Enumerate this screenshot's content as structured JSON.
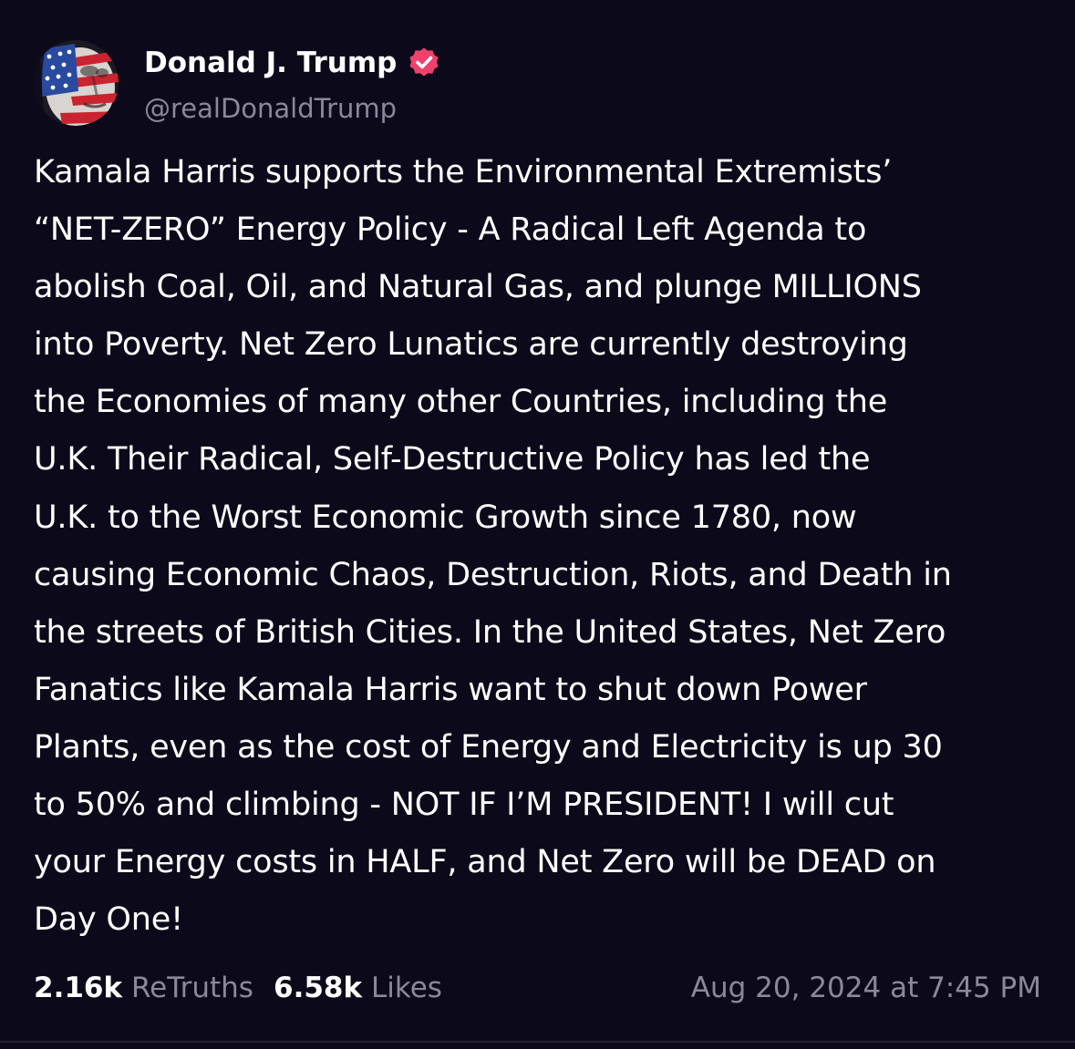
{
  "author": {
    "display_name": "Donald J. Trump",
    "handle": "@realDonaldTrump",
    "verified": true,
    "avatar_icon": "avatar-flag-portrait",
    "verified_icon": "verified-badge-icon"
  },
  "post": {
    "lines": [
      "Kamala Harris supports the Environmental Extremists’",
      "“NET-ZERO” Energy Policy - A Radical Left Agenda to",
      "abolish Coal, Oil, and Natural Gas, and plunge MILLIONS",
      "into Poverty. Net Zero Lunatics are currently destroying",
      "the Economies of many other Countries, including the",
      "U.K. Their Radical, Self-Destructive Policy has led the",
      "U.K. to the Worst Economic Growth since 1780, now",
      "causing Economic Chaos, Destruction, Riots, and Death in",
      "the streets of British Cities. In the United States, Net Zero",
      "Fanatics like Kamala Harris want to shut down Power",
      "Plants, even as the cost of Energy and Electricity is up 30",
      "to 50% and climbing - NOT IF I’M PRESIDENT! I will cut",
      "your Energy costs in HALF, and Net Zero will be DEAD on",
      "Day One!"
    ]
  },
  "stats": {
    "retruths_count": "2.16k",
    "retruths_label": "ReTruths",
    "likes_count": "6.58k",
    "likes_label": "Likes",
    "timestamp": "Aug 20, 2024 at 7:45 PM"
  },
  "colors": {
    "background": "#0c0a1a",
    "text_primary": "#ffffff",
    "text_secondary": "#8a8899",
    "verified_badge": "#f0416c"
  }
}
